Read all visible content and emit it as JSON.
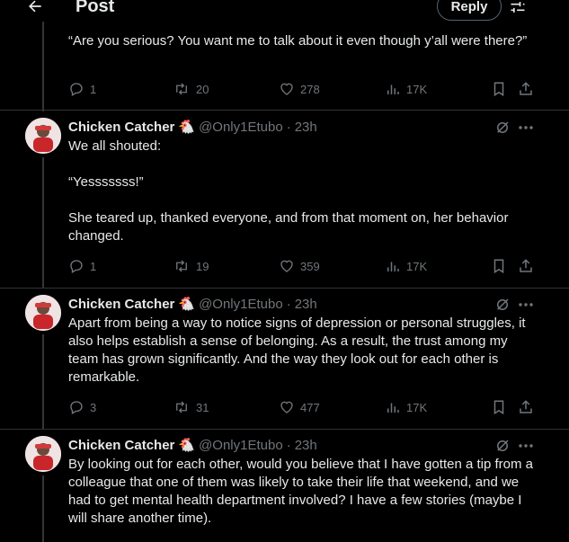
{
  "header": {
    "title": "Post",
    "reply_label": "Reply"
  },
  "top_post": {
    "text": "“Are you serious? You want me to talk about it even though y’all were there?”",
    "replies": "1",
    "reposts": "20",
    "likes": "278",
    "views": "17K"
  },
  "posts": [
    {
      "name": "Chicken Catcher",
      "emoji": "🐔",
      "handle": "@Only1Etubo",
      "dot": "·",
      "time": "23h",
      "text": "We all shouted:\n\n“Yesssssss!”\n\nShe teared up, thanked everyone, and from that moment on, her behavior changed.",
      "replies": "1",
      "reposts": "19",
      "likes": "359",
      "views": "17K"
    },
    {
      "name": "Chicken Catcher",
      "emoji": "🐔",
      "handle": "@Only1Etubo",
      "dot": "·",
      "time": "23h",
      "text": "Apart from being a way to notice signs of depression or personal struggles, it also helps establish a sense of belonging. As a result, the trust among my team has grown significantly. And the way they look out for each other is remarkable.",
      "replies": "3",
      "reposts": "31",
      "likes": "477",
      "views": "17K"
    },
    {
      "name": "Chicken Catcher",
      "emoji": "🐔",
      "handle": "@Only1Etubo",
      "dot": "·",
      "time": "23h",
      "text": "By looking out for each other, would you believe that I have gotten a tip from a colleague that one of them was likely to take their life that weekend, and we had to get mental health department involved? I have a few stories (maybe I will share another time)."
    }
  ],
  "icons": {
    "back": "arrow-left-icon",
    "settings": "sliders-icon",
    "reply": "comment-icon",
    "repost": "repost-icon",
    "like": "heart-icon",
    "views": "bar-chart-icon",
    "bookmark": "bookmark-icon",
    "share": "share-icon",
    "grok": "grok-icon",
    "more": "more-icon"
  },
  "colors": {
    "background": "#000000",
    "text": "#e7e9ea",
    "muted": "#71767b",
    "divider": "#2f3336"
  }
}
